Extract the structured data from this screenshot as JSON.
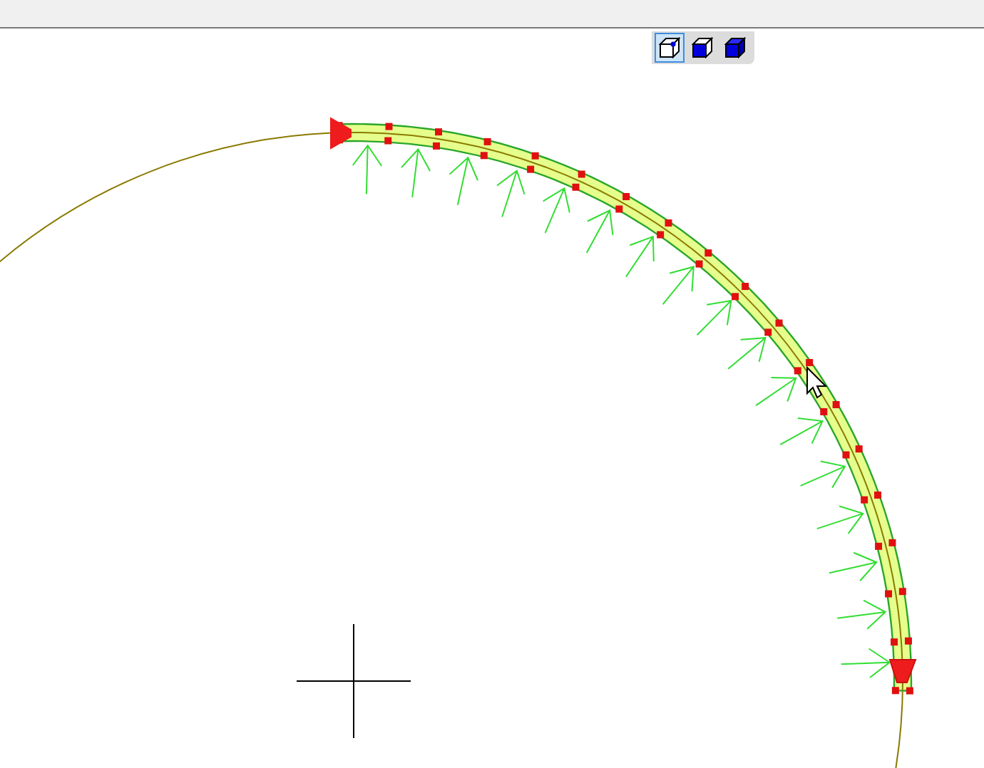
{
  "toolbar": {
    "buttons": [
      {
        "kind": "wireframe",
        "selected": true
      },
      {
        "kind": "shaded",
        "selected": false
      },
      {
        "kind": "solid",
        "selected": false
      }
    ]
  }
}
